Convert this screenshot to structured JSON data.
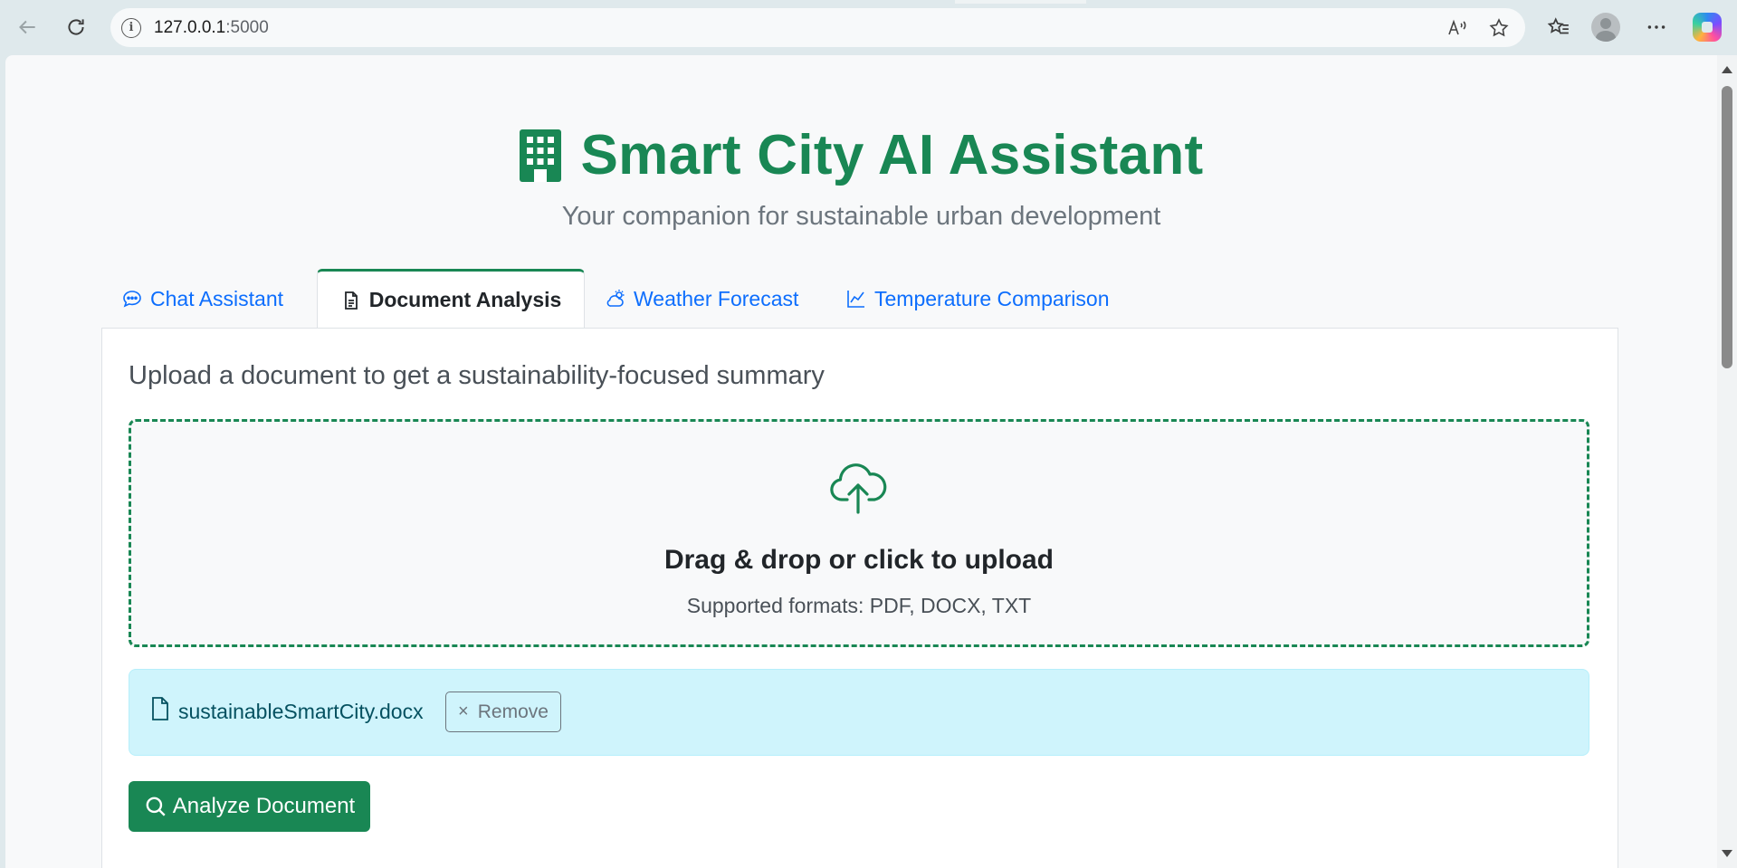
{
  "browser": {
    "url_host": "127.0.0.1",
    "url_port": ":5000"
  },
  "app": {
    "title": "Smart City AI Assistant",
    "subtitle": "Your companion for sustainable urban development",
    "brand_color": "#198754"
  },
  "tabs": [
    {
      "label": "Chat Assistant",
      "icon": "chat-icon",
      "active": false
    },
    {
      "label": "Document Analysis",
      "icon": "document-icon",
      "active": true
    },
    {
      "label": "Weather Forecast",
      "icon": "cloud-sun-icon",
      "active": false
    },
    {
      "label": "Temperature Comparison",
      "icon": "line-chart-icon",
      "active": false
    }
  ],
  "document_panel": {
    "intro": "Upload a document to get a sustainability-focused summary",
    "dropzone": {
      "title": "Drag & drop or click to upload",
      "formats": "Supported formats: PDF, DOCX, TXT",
      "icon": "cloud-upload-icon"
    },
    "selected_file": {
      "name": "sustainableSmartCity.docx",
      "remove_label": "Remove"
    },
    "analyze_label": "Analyze Document"
  }
}
